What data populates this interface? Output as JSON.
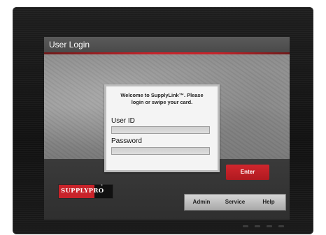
{
  "window": {
    "title": "User Login"
  },
  "login": {
    "welcome_line1": "Welcome to SupplyLink™.  Please",
    "welcome_line2": "login or swipe your card.",
    "userid_label": "User ID",
    "userid_value": "",
    "password_label": "Password",
    "password_value": ""
  },
  "actions": {
    "enter_label": "Enter"
  },
  "logo": {
    "text": "SUPPLYPRO",
    "mark": "®"
  },
  "nav": {
    "admin_label": "Admin",
    "service_label": "Service",
    "help_label": "Help"
  },
  "colors": {
    "accent": "#c8232a",
    "titlebar": "#4e4e4e",
    "panel": "#f4f4f4"
  }
}
